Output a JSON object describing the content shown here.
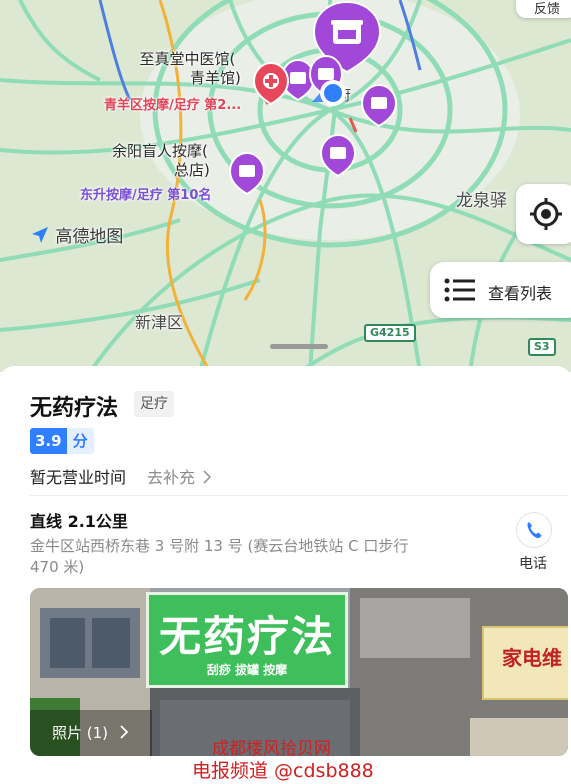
{
  "map": {
    "feedback_label": "反馈",
    "list_button_label": "查看列表",
    "logo_text": "高德地图",
    "place_labels": [
      "龙泉驿",
      "新津区"
    ],
    "road_signs": [
      "G4215",
      "S3"
    ],
    "partial_label": "府",
    "pois": [
      {
        "name_line1": "至真堂中医馆(",
        "name_line2": "青羊馆)",
        "tag": "青羊区按摩/足疗 第2...",
        "tag_color": "#e0455a"
      },
      {
        "name_line1": "余阳盲人按摩(",
        "name_line2": "总店)",
        "tag": "东升按摩/足疗 第10名",
        "tag_color": "#7a4fd6"
      }
    ],
    "colors": {
      "pin_purple": "#a248d8",
      "pin_red": "#e8465b",
      "location_blue": "#2f7fff",
      "road_green": "#8fdcb6"
    }
  },
  "place": {
    "title": "无药疗法",
    "category": "足疗",
    "rating": "3.9",
    "rating_unit": "分",
    "hours": "暂无营业时间",
    "hours_add": "去补充",
    "distance": "直线 2.1公里",
    "address": "金牛区站西桥东巷 3 号附 13 号 (赛云台地铁站 C 口步行 470 米)",
    "phone_label": "电话",
    "photos_label": "照片 (1)",
    "photo_sign_main": "无药疗法",
    "photo_sign_sub": "刮痧  拔罐  按摩",
    "photo_sign2": "家电维"
  },
  "watermark": {
    "line1": "成都楼风拾贝网",
    "line2": "电报频道 @cdsb888"
  }
}
